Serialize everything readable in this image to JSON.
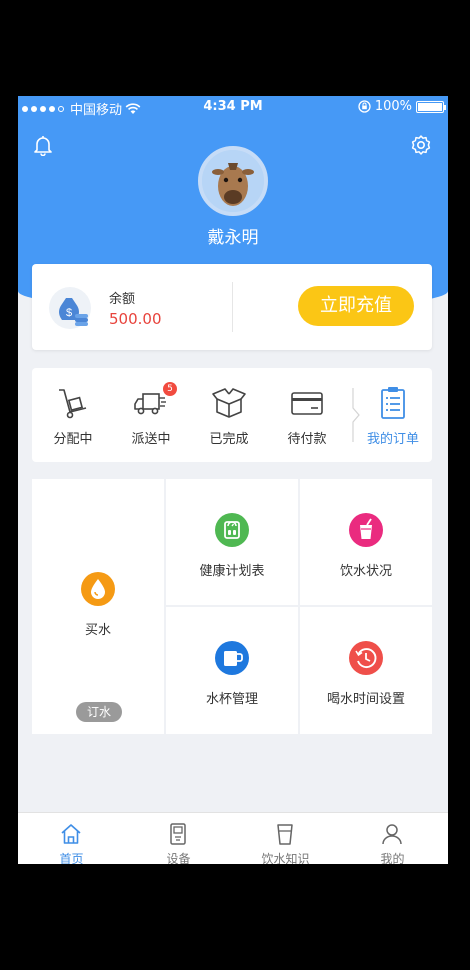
{
  "status_bar": {
    "carrier": "中国移动",
    "time": "4:34 PM",
    "battery": "100%",
    "battery_level": 1.0
  },
  "header": {
    "user_name": "戴永明",
    "bell_icon": "bell-icon",
    "settings_icon": "gear-icon"
  },
  "balance": {
    "label": "余额",
    "value": "500.00",
    "button": "立即充值",
    "value_color": "#e8433c",
    "button_color": "#fbc615"
  },
  "orders": {
    "badge_count": "5",
    "items": [
      {
        "label": "分配中",
        "icon": "hand-truck-icon"
      },
      {
        "label": "派送中",
        "icon": "delivery-truck-icon"
      },
      {
        "label": "已完成",
        "icon": "open-box-icon"
      },
      {
        "label": "待付款",
        "icon": "credit-card-icon"
      },
      {
        "label": "我的订单",
        "icon": "clipboard-list-icon"
      }
    ]
  },
  "features": {
    "buy_water": {
      "label": "买水",
      "badge": "订水",
      "icon": "water-drop-icon"
    },
    "health_plan": {
      "label": "健康计划表",
      "icon": "scale-icon"
    },
    "drink_status": {
      "label": "饮水状况",
      "icon": "drink-cup-icon"
    },
    "cup_management": {
      "label": "水杯管理",
      "icon": "mug-icon"
    },
    "drink_time": {
      "label": "喝水时间设置",
      "icon": "clock-icon"
    }
  },
  "tab_bar": {
    "accent": "#3f8ee6",
    "tabs": [
      {
        "label": "首页",
        "icon": "home-icon",
        "active": true
      },
      {
        "label": "设备",
        "icon": "water-dispenser-icon",
        "active": false
      },
      {
        "label": "饮水知识",
        "icon": "glass-icon",
        "active": false
      },
      {
        "label": "我的",
        "icon": "person-icon",
        "active": false
      }
    ]
  },
  "colors": {
    "header_blue": "#4699f6",
    "background": "#eff1f5"
  }
}
